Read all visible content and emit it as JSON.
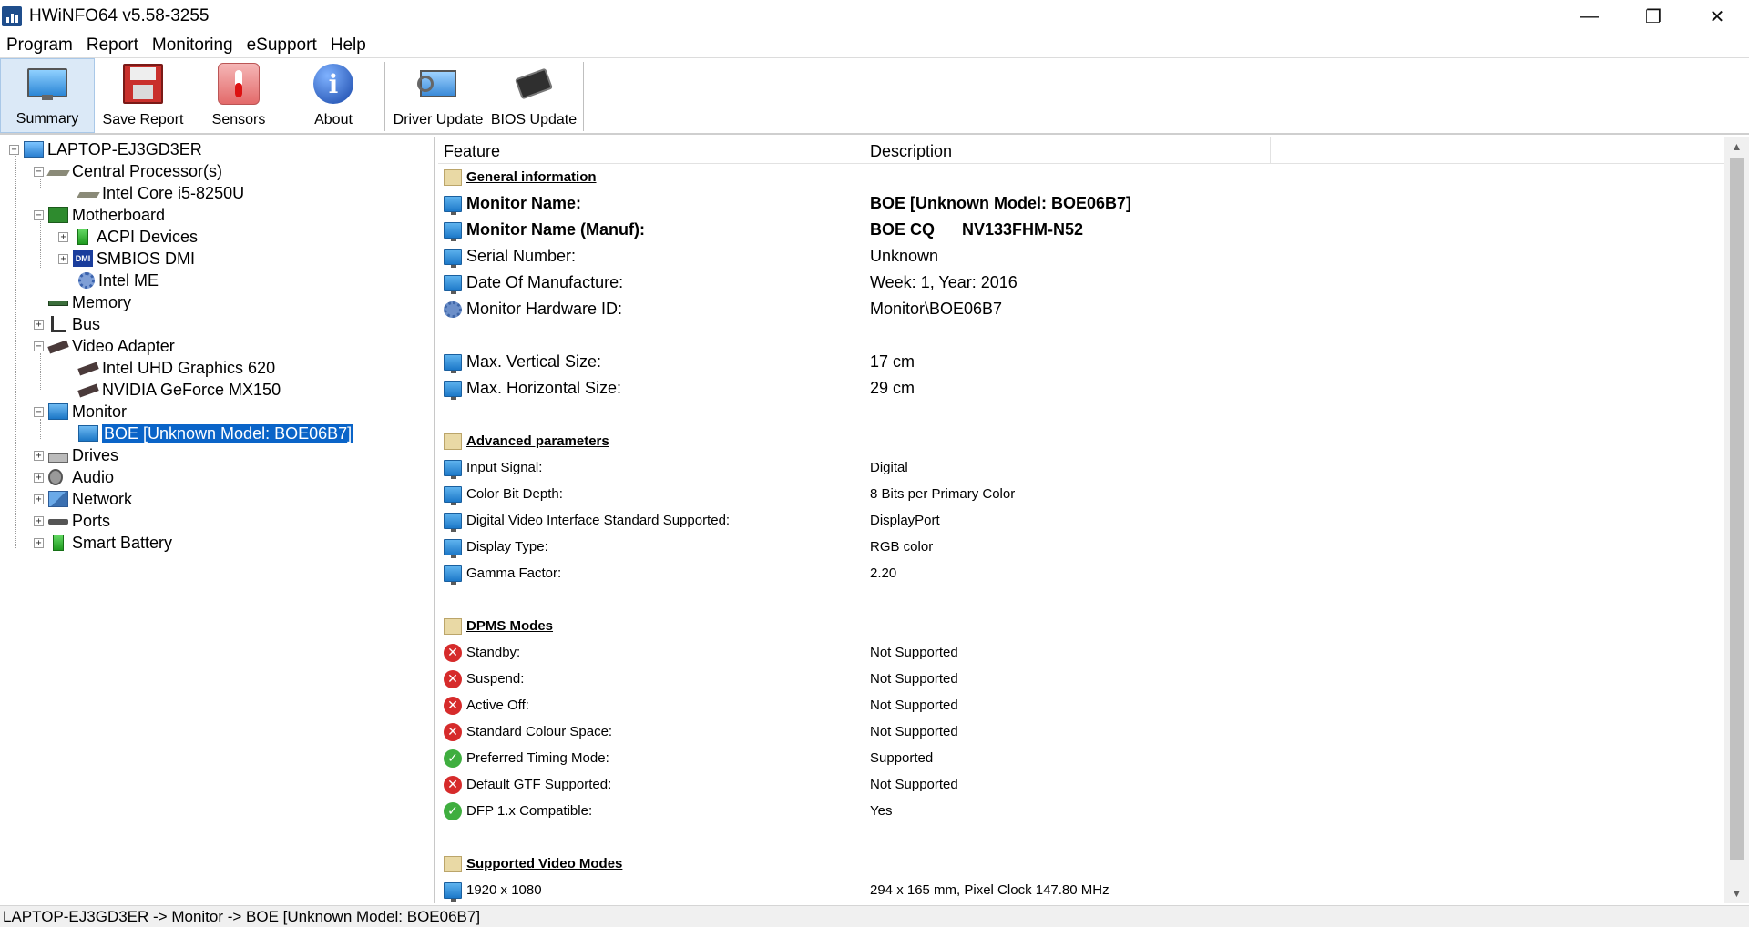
{
  "window": {
    "title": "HWiNFO64 v5.58-3255"
  },
  "menu": [
    "Program",
    "Report",
    "Monitoring",
    "eSupport",
    "Help"
  ],
  "toolbar": {
    "summary": "Summary",
    "save_report": "Save Report",
    "sensors": "Sensors",
    "about": "About",
    "driver_update": "Driver Update",
    "bios_update": "BIOS Update"
  },
  "tree": {
    "root": "LAPTOP-EJ3GD3ER",
    "cpu": "Central Processor(s)",
    "cpu_child": "Intel Core i5-8250U",
    "motherboard": "Motherboard",
    "acpi": "ACPI Devices",
    "smbios": "SMBIOS DMI",
    "intel_me": "Intel ME",
    "memory": "Memory",
    "bus": "Bus",
    "video": "Video Adapter",
    "gpu1": "Intel UHD Graphics 620",
    "gpu2": "NVIDIA GeForce MX150",
    "monitor": "Monitor",
    "monitor_child": "BOE [Unknown Model: BOE06B7]",
    "drives": "Drives",
    "audio": "Audio",
    "network": "Network",
    "ports": "Ports",
    "battery": "Smart Battery"
  },
  "columns": {
    "feature": "Feature",
    "description": "Description"
  },
  "details": {
    "general_title": "General information",
    "monitor_name_label": "Monitor Name:",
    "monitor_name_value": "BOE [Unknown Model: BOE06B7]",
    "monitor_manuf_label": "Monitor Name (Manuf):",
    "monitor_manuf_value": "BOE CQ      NV133FHM-N52",
    "serial_label": "Serial Number:",
    "serial_value": "Unknown",
    "date_label": "Date Of Manufacture:",
    "date_value": "Week: 1, Year: 2016",
    "hwid_label": "Monitor Hardware ID:",
    "hwid_value": "Monitor\\BOE06B7",
    "vsize_label": "Max. Vertical Size:",
    "vsize_value": "17 cm",
    "hsize_label": "Max. Horizontal Size:",
    "hsize_value": "29 cm",
    "advanced_title": "Advanced parameters",
    "input_label": "Input Signal:",
    "input_value": "Digital",
    "bitdepth_label": "Color Bit Depth:",
    "bitdepth_value": "8 Bits per Primary Color",
    "dvi_label": "Digital Video Interface Standard Supported:",
    "dvi_value": "DisplayPort",
    "disptype_label": "Display Type:",
    "disptype_value": "RGB color",
    "gamma_label": "Gamma Factor:",
    "gamma_value": "2.20",
    "dpms_title": "DPMS Modes",
    "standby_label": "Standby:",
    "standby_value": "Not Supported",
    "suspend_label": "Suspend:",
    "suspend_value": "Not Supported",
    "activeoff_label": "Active Off:",
    "activeoff_value": "Not Supported",
    "stdcolour_label": "Standard Colour Space:",
    "stdcolour_value": "Not Supported",
    "preftiming_label": "Preferred Timing Mode:",
    "preftiming_value": "Supported",
    "gtf_label": "Default GTF Supported:",
    "gtf_value": "Not Supported",
    "dfp_label": "DFP 1.x Compatible:",
    "dfp_value": "Yes",
    "videomodes_title": "Supported Video Modes",
    "mode1_label": "1920 x 1080",
    "mode1_value": "294 x 165 mm, Pixel Clock 147.80 MHz"
  },
  "status": "LAPTOP-EJ3GD3ER -> Monitor -> BOE [Unknown Model: BOE06B7]",
  "icons": {
    "supported": "check-icon",
    "not_supported": "x-icon",
    "monitor": "monitor-icon",
    "section": "folder-icon"
  },
  "colors": {
    "selection": "#0a64c8",
    "not_supported": "#d62b2b",
    "supported": "#3fae3f"
  }
}
